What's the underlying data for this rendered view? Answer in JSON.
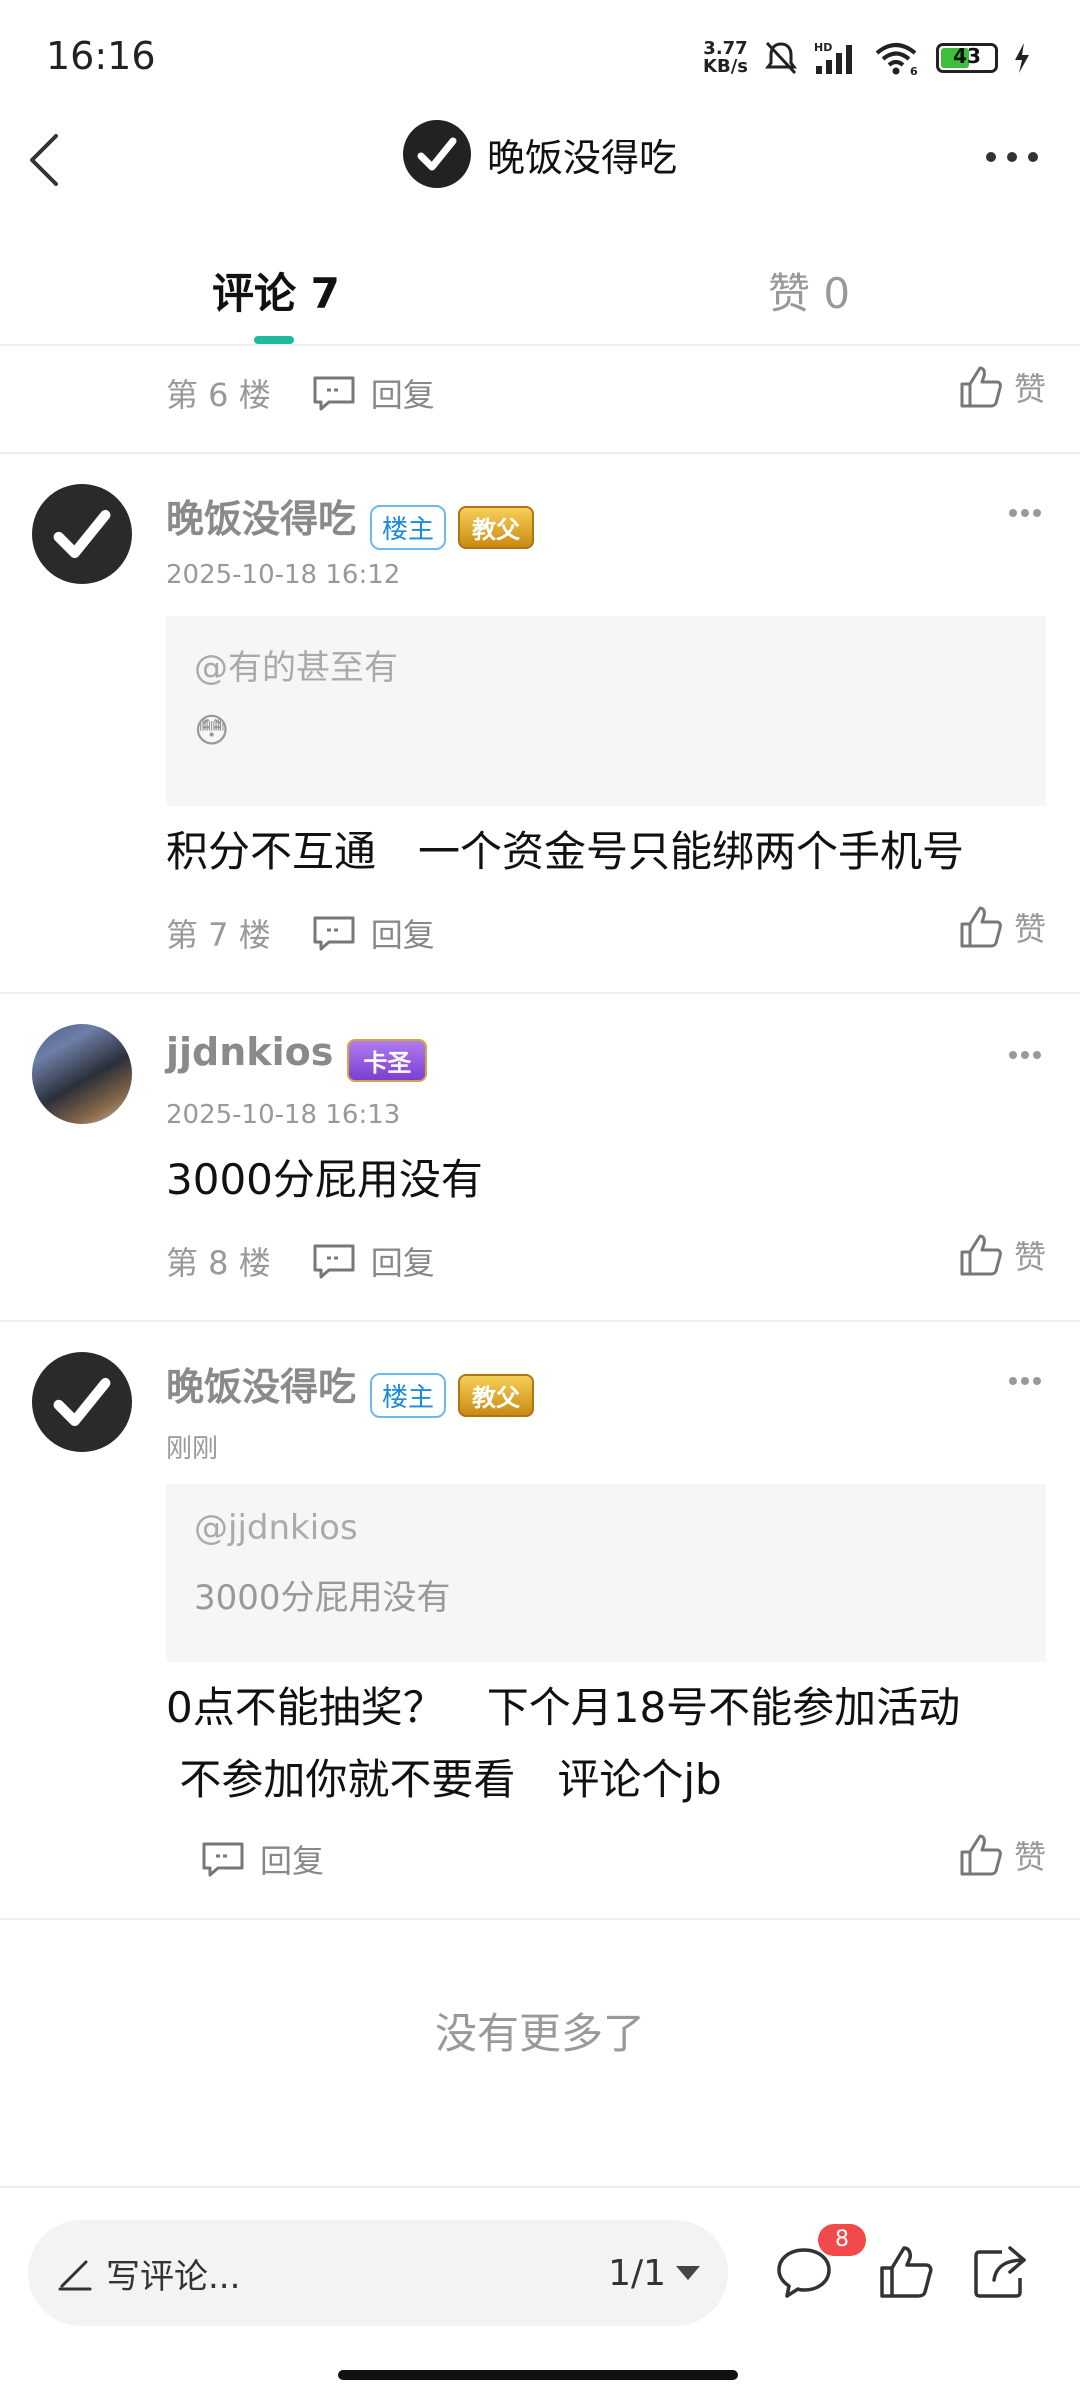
{
  "status_bar": {
    "time": "16:16",
    "net_speed_value": "3.77",
    "net_speed_unit": "KB/s",
    "signal_label": "HD",
    "wifi_label": "6",
    "battery": "43",
    "icons": [
      "mute-icon",
      "signal-icon",
      "wifi-icon",
      "battery-icon",
      "charging-icon"
    ]
  },
  "header": {
    "title": "晚饭没得吃"
  },
  "tabs": [
    {
      "label": "评论 7",
      "active": true
    },
    {
      "label": "赞 0",
      "active": false
    }
  ],
  "comments": [
    {
      "floor": "第 6 楼",
      "reply_label": "回复",
      "like_label": "赞"
    },
    {
      "username": "晚饭没得吃",
      "owner_badge": "楼主",
      "title_badge": "教父",
      "time": "2025-10-18 16:12",
      "quote_user": "@有的甚至有",
      "quote_text": "😳",
      "text": "积分不互通　一个资金号只能绑两个手机号",
      "floor": "第 7 楼",
      "reply_label": "回复",
      "like_label": "赞"
    },
    {
      "username": "jjdnkios",
      "title_badge": "卡圣",
      "time": "2025-10-18 16:13",
      "text": "3000分屁用没有",
      "floor": "第 8 楼",
      "reply_label": "回复",
      "like_label": "赞"
    },
    {
      "username": "晚饭没得吃",
      "owner_badge": "楼主",
      "title_badge": "教父",
      "time": "刚刚",
      "quote_user": "@jjdnkios",
      "quote_text": "3000分屁用没有",
      "text_line1": "0点不能抽奖？　下个月18号不能参加活动",
      "text_line2": " 不参加你就不要看　评论个jb",
      "reply_label": "回复",
      "like_label": "赞"
    }
  ],
  "footer_message": "没有更多了",
  "bottom_bar": {
    "input_placeholder": "写评论...",
    "page_indicator": "1/1",
    "comment_count": "8",
    "colors": {
      "accent": "#21b99b",
      "badge": "#f24a4a"
    }
  }
}
